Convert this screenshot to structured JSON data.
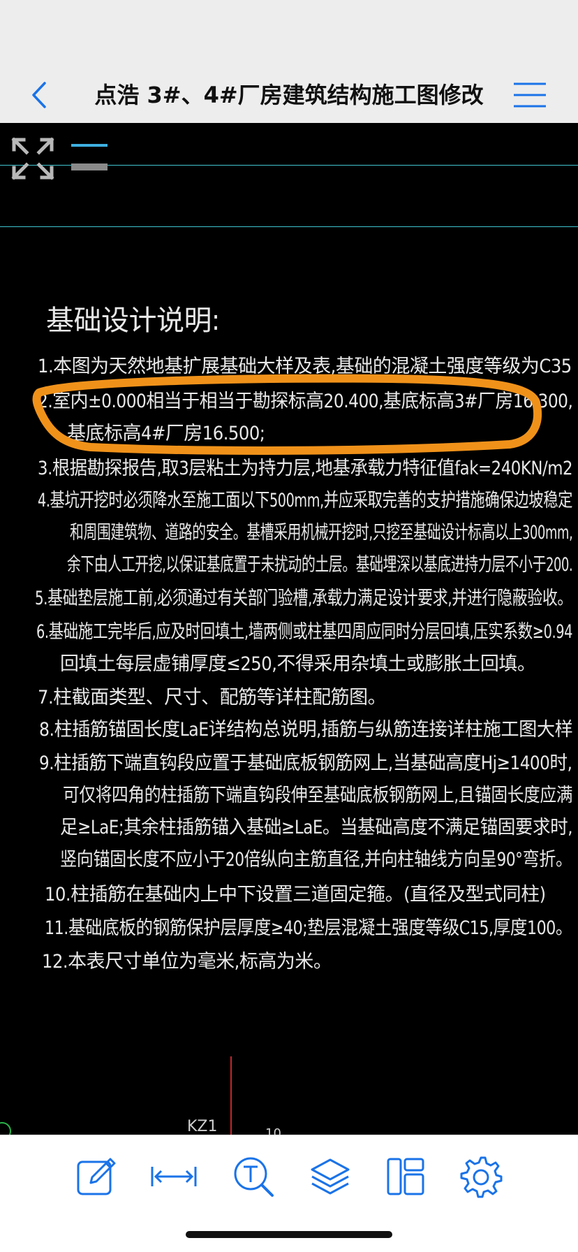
{
  "nav": {
    "title": "点浩 3#、4#厂房建筑结构施工图修改",
    "back_icon": "chevron-left-icon",
    "menu_icon": "hamburger-menu-icon",
    "accent_color": "#1a73e8"
  },
  "drawing": {
    "heading": "基础设计说明:",
    "lines": [
      "1.本图为天然地基扩展基础大样及表,基础的混凝土强度等级为C35",
      "2.室内±0.000相当于相当于勘探标高20.400,基底标高3#厂房16.300,",
      "基底标高4#厂房16.500;",
      "3.根据勘探报告,取3层粘土为持力层,地基承载力特征值fak=240KN/m2",
      "4.基坑开挖时必须降水至施工面以下500mm,并应采取完善的支护措施确保边坡稳定",
      "和周围建筑物、道路的安全。基槽采用机械开挖时,只挖至基础设计标高以上300mm,",
      "余下由人工开挖,以保证基底置于未扰动的土层。基础埋深以基底进持力层不小于200.",
      "5.基础垫层施工前,必须通过有关部门验槽,承载力满足设计要求,并进行隐蔽验收。",
      "6.基础施工完毕后,应及时回填土,墙两侧或柱基四周应同时分层回填,压实系数≥0.94",
      "回填土每层虚铺厚度≤250,不得采用杂填土或膨胀土回填。",
      "7.柱截面类型、尺寸、配筋等详柱配筋图。",
      "8.柱插筋锚固长度LaE详结构总说明,插筋与纵筋连接详柱施工图大样",
      "9.柱插筋下端直钩段应置于基础底板钢筋网上,当基础高度Hj≥1400时,",
      "可仅将四角的柱插筋下端直钩段伸至基础底板钢筋网上,且锚固长度应满",
      "足≥LaE;其余柱插筋锚入基础≥LaE。当基础高度不满足锚固要求时,",
      "竖向锚固长度不应小于20倍纵向主筋直径,并向柱轴线方向呈90°弯折。",
      "10.柱插筋在基础内上中下设置三道固定箍。(直径及型式同柱)",
      "11.基础底板的钢筋保护层厚度≥40;垫层混凝土强度等级C15,厚度100。",
      "12.本表尺寸单位为毫米,标高为米。"
    ],
    "partial_label": "KZ1",
    "partial_tail": "10",
    "annotation_color": "#f0921a",
    "grid_line_color": "#3fc6d0"
  },
  "toolbar": {
    "items": [
      {
        "icon": "edit-note-icon"
      },
      {
        "icon": "measure-distance-icon"
      },
      {
        "icon": "text-search-icon"
      },
      {
        "icon": "layers-icon"
      },
      {
        "icon": "layout-panels-icon"
      },
      {
        "icon": "settings-gear-icon"
      }
    ],
    "icon_color": "#1a73e8"
  }
}
